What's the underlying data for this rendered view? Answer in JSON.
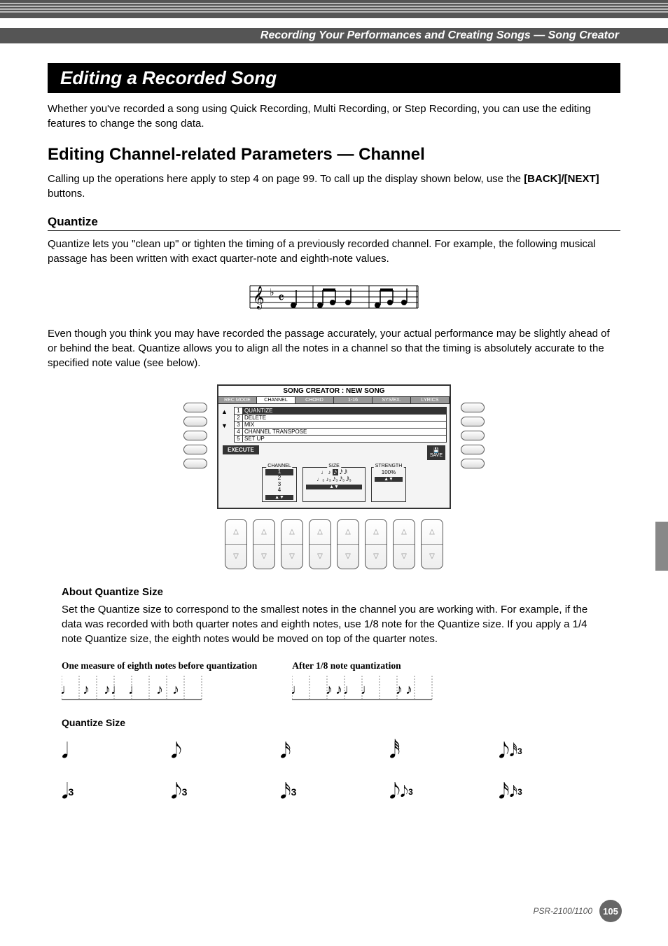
{
  "chapter_header": "Recording Your Performances and Creating Songs — Song Creator",
  "section_title": "Editing a Recorded Song",
  "intro": "Whether you've recorded a song using Quick Recording, Multi Recording, or Step Recording, you can use the editing features to change the song data.",
  "h2": "Editing Channel-related Parameters — Channel",
  "h2_body_pre": "Calling up the operations here apply to step 4 on page 99. To call up the display shown below, use the ",
  "h2_body_bold": "[BACK]/[NEXT]",
  "h2_body_post": " buttons.",
  "quantize": {
    "title": "Quantize",
    "p1": "Quantize lets you \"clean up\" or tighten the timing of a previously recorded channel. For example, the following musical passage has been written with exact quarter-note and eighth-note values.",
    "p2": "Even though you think you may have recorded the passage accurately, your actual performance may be slightly ahead of or behind the beat. Quantize allows you to align all the notes in a channel so that the timing is absolutely accurate to the specified note value (see below)."
  },
  "lcd": {
    "title": "SONG CREATOR : NEW SONG",
    "tabs": [
      "REC MODE",
      "CHANNEL",
      "CHORD",
      "1-16",
      "SYS/EX.",
      "LYRICS"
    ],
    "active_tab": 1,
    "menu": [
      {
        "num": "1",
        "label": "QUANTIZE",
        "selected": true
      },
      {
        "num": "2",
        "label": "DELETE"
      },
      {
        "num": "3",
        "label": "MIX"
      },
      {
        "num": "4",
        "label": "CHANNEL TRANSPOSE"
      },
      {
        "num": "5",
        "label": "SET UP"
      }
    ],
    "execute": "EXECUTE",
    "save": "SAVE",
    "params": {
      "channel": {
        "label": "CHANNEL",
        "values": [
          "1",
          "2",
          "3",
          "4"
        ]
      },
      "size": {
        "label": "SIZE"
      },
      "strength": {
        "label": "STRENGTH",
        "value": "100%"
      }
    }
  },
  "about": {
    "title": "About Quantize Size",
    "body": "Set the Quantize size to correspond to the smallest notes in the channel you are working with. For example, if the data was recorded with both quarter notes and eighth notes, use 1/8 note for the Quantize size. If you apply a 1/4 note Quantize size, the eighth notes would be moved on top of the quarter notes.",
    "example_before": "One measure of eighth notes before quantization",
    "example_after": "After 1/8 note quantization",
    "qsize_title": "Quantize Size"
  },
  "footer": {
    "model": "PSR-2100/1100",
    "page": "105"
  }
}
